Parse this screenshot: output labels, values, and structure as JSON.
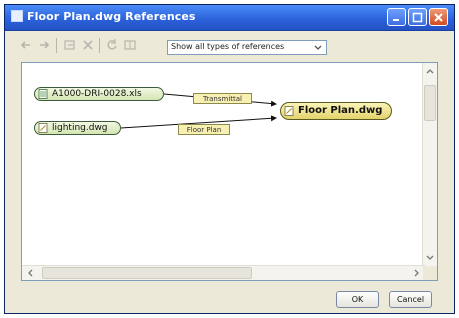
{
  "window": {
    "title": "Floor Plan.dwg References"
  },
  "toolbar": {
    "filter_select": {
      "selected": "Show all types of references"
    }
  },
  "graph": {
    "nodes": [
      {
        "id": "xls",
        "label": "A1000-DRI-0028.xls",
        "icon": "spreadsheet-file-icon"
      },
      {
        "id": "lighting",
        "label": "lighting.dwg",
        "icon": "drawing-file-icon"
      },
      {
        "id": "main",
        "label": "Floor Plan.dwg",
        "icon": "drawing-file-icon"
      }
    ],
    "edges": [
      {
        "from": "xls",
        "to": "main",
        "label": "Transmittal"
      },
      {
        "from": "lighting",
        "to": "main",
        "label": "Floor Plan"
      }
    ]
  },
  "footer": {
    "ok_label": "OK",
    "cancel_label": "Cancel"
  },
  "colors": {
    "title_bar": "#2a60d9",
    "node_fill": "#d3e6b1",
    "main_node_fill": "#e3d36c",
    "edge_label_fill": "#f7f0b2"
  }
}
